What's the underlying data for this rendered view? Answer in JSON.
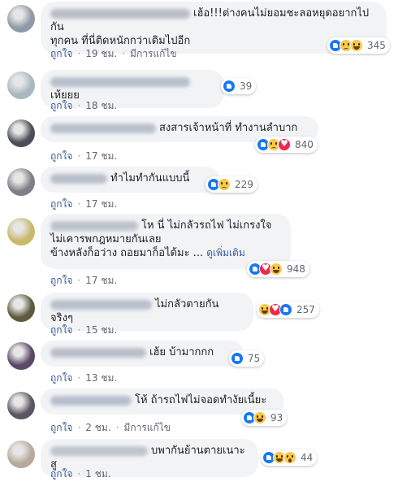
{
  "comments": [
    {
      "avatar_color": "#8e9aa5",
      "name_color": "#b8bdc7",
      "name_width": 172,
      "lines": [
        "เฮ้อ!!!ต่างคนไม่ยอมชะลอหยุดอยากไปกัน",
        "ทุกคน ที่นี่ติดหนักกว่าเดิมไปอีก"
      ],
      "reactions": [
        "like",
        "sad",
        "haha"
      ],
      "reaction_count": "345",
      "like_label": "ถูกใจ",
      "time": "19 ชม.",
      "edited": "มีการแก้ไข"
    },
    {
      "avatar_color": "#a9b7bf",
      "name_color": "#b7bfcc",
      "name_width": 172,
      "lines": [
        "เห้ยยย"
      ],
      "reactions": [
        "like"
      ],
      "reaction_count": "39",
      "like_label": "ถูกใจ",
      "time": "18 ชม.",
      "edited": ""
    },
    {
      "avatar_color": "#4a4f57",
      "name_color": "#b7c0cc",
      "name_width": 130,
      "lines": [
        "สงสารเจ้าหน้าที่ ทำงานลำบาก"
      ],
      "reactions": [
        "like",
        "sad",
        "love"
      ],
      "reaction_count": "840",
      "like_label": "ถูกใจ",
      "time": "17 ชม.",
      "edited": ""
    },
    {
      "avatar_color": "#7e7f86",
      "name_color": "#b9bfc9",
      "name_width": 70,
      "lines": [
        "ทำไมทำกันแบบนี้"
      ],
      "reactions": [
        "like",
        "sad"
      ],
      "reaction_count": "229",
      "like_label": "ถูกใจ",
      "time": "17 ชม.",
      "edited": ""
    },
    {
      "avatar_color": "#c9b96b",
      "name_color": "#bcc2cb",
      "name_width": 108,
      "lines": [
        "โห นี่ ไม่กลัวรถไฟ ไม่เกรงใจ",
        "ไม่เคารพกฎหมายกันเลย",
        "ข้างหลังก็อว่าง ถอยมาก็อได้มะ ..."
      ],
      "see_more": "ดูเพิ่มเติม",
      "reactions": [
        "like",
        "love",
        "haha"
      ],
      "reaction_count": "948",
      "like_label": "ถูกใจ",
      "time": "17 ชม.",
      "edited": ""
    },
    {
      "avatar_color": "#5d5a3f",
      "name_color": "#b7c0cc",
      "name_width": 125,
      "lines": [
        "ไม่กลัวตายกัน จริงๆ"
      ],
      "reactions": [
        "haha",
        "love",
        "like"
      ],
      "reaction_count": "257",
      "like_label": "ถูกใจ",
      "time": "15 ชม.",
      "edited": ""
    },
    {
      "avatar_color": "#5b4766",
      "name_color": "#b9bfca",
      "name_width": 118,
      "lines": [
        "เฮ้ย บ้ามากกก"
      ],
      "reactions": [
        "like"
      ],
      "reaction_count": "75",
      "like_label": "ถูกใจ",
      "time": "13 ชม.",
      "edited": ""
    },
    {
      "avatar_color": "#5a5560",
      "name_color": "#b6bfcd",
      "name_width": 100,
      "lines": [
        "โห้ ถ้ารถไฟไม่จอดทำงัยเนี้ยะ"
      ],
      "reactions": [
        "like",
        "haha"
      ],
      "reaction_count": "93",
      "like_label": "ถูกใจ",
      "time": "2 ชม.",
      "edited": "มีการแก้ไข"
    },
    {
      "avatar_color": "#b8a99a",
      "name_color": "#bfc5cc",
      "name_width": 120,
      "lines": [
        "บพากันย้านตายเนาะสู"
      ],
      "reactions": [
        "like",
        "haha",
        "wow"
      ],
      "reaction_count": "44",
      "like_label": "ถูกใจ",
      "time": "1 ชม.",
      "edited": ""
    }
  ]
}
